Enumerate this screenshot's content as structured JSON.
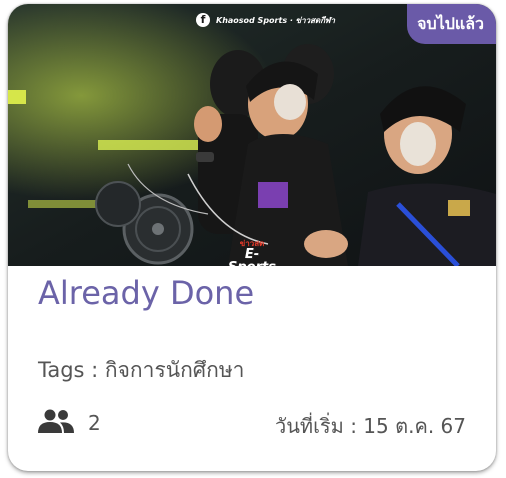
{
  "card": {
    "status_badge": "จบไปแล้ว",
    "photo_watermark": "Khaosod Sports · ข่าวสดกีฬา",
    "photo_logo_top": "ข่าวสด",
    "photo_logo_main": "E-Sports",
    "title": "Already Done",
    "tags_text": "Tags : กิจการนักศึกษา",
    "members_icon": "people-icon",
    "members_count": "2",
    "start_date_text": "วันที่เริ่ม : 15 ต.ค. 67"
  },
  "colors": {
    "badge_bg": "#6a5aa8",
    "title": "#6b63a8",
    "text": "#555555"
  }
}
